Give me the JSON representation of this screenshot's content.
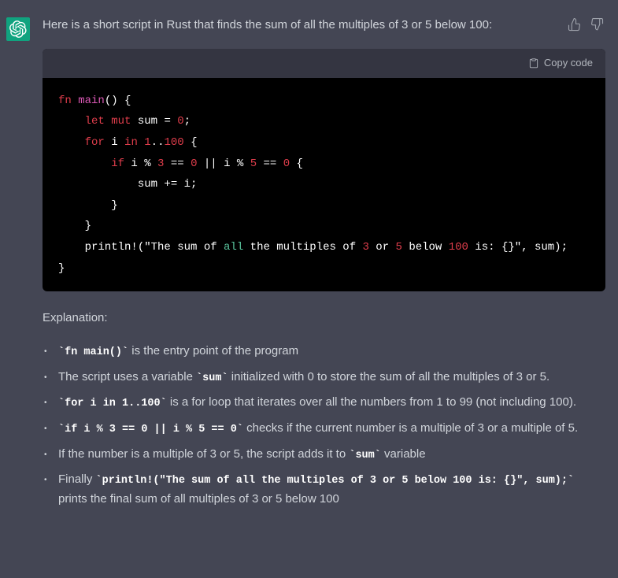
{
  "message": {
    "intro": "Here is a short script in Rust that finds the sum of all the multiples of 3 or 5 below 100:",
    "copy_label": "Copy code",
    "explanation_title": "Explanation:",
    "explanations": [
      {
        "code": "`fn main()`",
        "text_after": " is the entry point of the program"
      },
      {
        "text_before": "The script uses a variable ",
        "code": "`sum`",
        "text_after": " initialized with 0 to store the sum of all the multiples of 3 or 5."
      },
      {
        "code": "`for i in 1..100`",
        "text_after": " is a for loop that iterates over all the numbers from 1 to 99 (not including 100)."
      },
      {
        "code": "`if i % 3 == 0 || i % 5 == 0`",
        "text_after": " checks if the current number is a multiple of 3 or a multiple of 5."
      },
      {
        "text_before": "If the number is a multiple of 3 or 5, the script adds it to ",
        "code": "`sum`",
        "text_after": " variable"
      },
      {
        "text_before": "Finally ",
        "code": "`println!(\"The sum of all the multiples of 3 or 5 below 100 is: {}\", sum);`",
        "text_after": " prints the final sum of all multiples of 3 or 5 below 100"
      }
    ],
    "code_tokens": [
      [
        {
          "t": "fn",
          "c": "kw"
        },
        {
          "t": " ",
          "c": "op"
        },
        {
          "t": "main",
          "c": "fn"
        },
        {
          "t": "() {",
          "c": "punct"
        }
      ],
      [
        {
          "t": "    ",
          "c": "op"
        },
        {
          "t": "let",
          "c": "kw"
        },
        {
          "t": " ",
          "c": "op"
        },
        {
          "t": "mut",
          "c": "kw"
        },
        {
          "t": " sum = ",
          "c": "op"
        },
        {
          "t": "0",
          "c": "num"
        },
        {
          "t": ";",
          "c": "punct"
        }
      ],
      [
        {
          "t": "    ",
          "c": "op"
        },
        {
          "t": "for",
          "c": "kw"
        },
        {
          "t": " i ",
          "c": "op"
        },
        {
          "t": "in",
          "c": "kw"
        },
        {
          "t": " ",
          "c": "op"
        },
        {
          "t": "1",
          "c": "num"
        },
        {
          "t": "..",
          "c": "op"
        },
        {
          "t": "100",
          "c": "num"
        },
        {
          "t": " {",
          "c": "punct"
        }
      ],
      [
        {
          "t": "        ",
          "c": "op"
        },
        {
          "t": "if",
          "c": "kw"
        },
        {
          "t": " i % ",
          "c": "op"
        },
        {
          "t": "3",
          "c": "num"
        },
        {
          "t": " == ",
          "c": "op"
        },
        {
          "t": "0",
          "c": "num"
        },
        {
          "t": " || i % ",
          "c": "op"
        },
        {
          "t": "5",
          "c": "num"
        },
        {
          "t": " == ",
          "c": "op"
        },
        {
          "t": "0",
          "c": "num"
        },
        {
          "t": " {",
          "c": "punct"
        }
      ],
      [
        {
          "t": "            sum += i;",
          "c": "op"
        }
      ],
      [
        {
          "t": "        }",
          "c": "punct"
        }
      ],
      [
        {
          "t": "    }",
          "c": "punct"
        }
      ],
      [
        {
          "t": "    println!(",
          "c": "op"
        },
        {
          "t": "\"The sum of ",
          "c": "str"
        },
        {
          "t": "all",
          "c": "all"
        },
        {
          "t": " the multiples of ",
          "c": "str"
        },
        {
          "t": "3",
          "c": "num"
        },
        {
          "t": " or ",
          "c": "str"
        },
        {
          "t": "5",
          "c": "num"
        },
        {
          "t": " below ",
          "c": "str"
        },
        {
          "t": "100",
          "c": "num"
        },
        {
          "t": " is: {}\"",
          "c": "str"
        },
        {
          "t": ", sum);",
          "c": "op"
        }
      ],
      [
        {
          "t": "}",
          "c": "punct"
        }
      ]
    ]
  }
}
